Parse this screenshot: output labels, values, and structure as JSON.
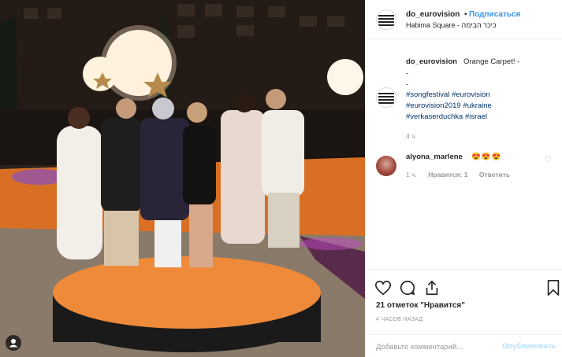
{
  "post": {
    "username": "do_eurovision",
    "follow_label": "Подписаться",
    "separator": "•",
    "location": "Habima Square - כיכר הבימה",
    "caption_title": "Orange Carpet! -",
    "caption_dashes": [
      "-",
      "-"
    ],
    "hashtags": [
      "#songfestival",
      "#eurovision",
      "#eurovision2019",
      "#ukraine",
      "#verkaserduchka",
      "#israel"
    ],
    "caption_time": "4 ч."
  },
  "comments": [
    {
      "username": "alyona_marlene",
      "text": "😍😍😍",
      "time": "1 ч.",
      "likes_label": "Нравится: 1",
      "reply_label": "Ответить"
    }
  ],
  "actions": {
    "like_icon": "heart-outline",
    "comment_icon": "speech-bubble",
    "share_icon": "share-arrow",
    "save_icon": "bookmark",
    "likes_text": "21 отметок \"Нравится\"",
    "time_ago": "4 ЧАСОВ НАЗАД"
  },
  "comment_box": {
    "placeholder": "Добавьте комментарий...",
    "publish_label": "Опубликовать"
  },
  "photo": {
    "user_tag_icon": "person-icon"
  },
  "colors": {
    "link": "#003569",
    "follow": "#3897f0",
    "publish_disabled": "#b2dffc",
    "orange_carpet": "#e07a2a"
  }
}
